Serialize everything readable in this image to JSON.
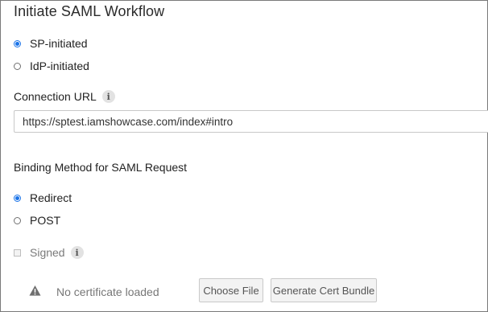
{
  "title": "Initiate SAML Workflow",
  "initiation": {
    "options": [
      {
        "label": "SP-initiated",
        "checked": true
      },
      {
        "label": "IdP-initiated",
        "checked": false
      }
    ]
  },
  "connection": {
    "label": "Connection URL",
    "info_icon": "i",
    "value": "https://sptest.iamshowcase.com/index#intro"
  },
  "binding": {
    "label": "Binding Method for SAML Request",
    "options": [
      {
        "label": "Redirect",
        "checked": true
      },
      {
        "label": "POST",
        "checked": false
      }
    ]
  },
  "signed": {
    "label": "Signed",
    "checked": false,
    "info_icon": "i"
  },
  "certificate": {
    "status": "No certificate loaded",
    "icon": "warning-icon",
    "choose_label": "Choose File",
    "generate_label": "Generate Cert Bundle"
  },
  "colors": {
    "accent": "#1a73e8",
    "border": "#7a7a7a",
    "button_bg": "#f3f3f3"
  }
}
